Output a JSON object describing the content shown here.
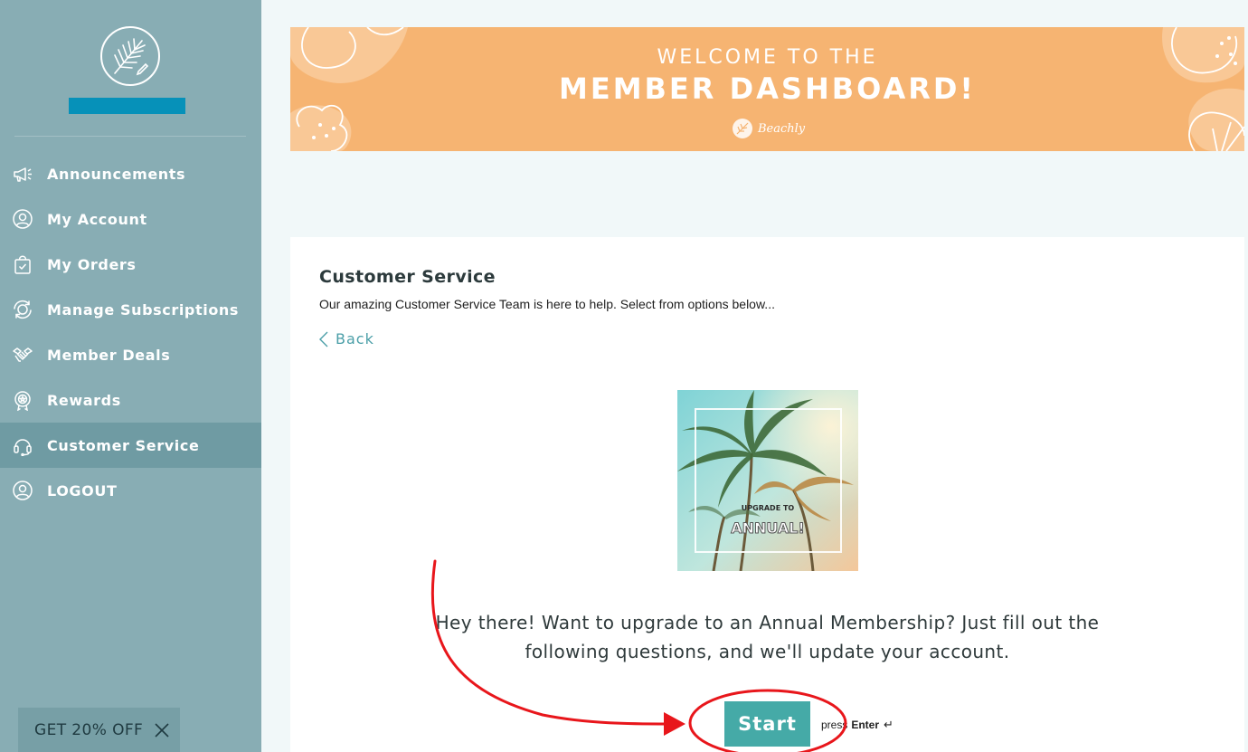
{
  "sidebar": {
    "items": [
      {
        "label": "Announcements",
        "icon": "megaphone-icon",
        "active": false
      },
      {
        "label": "My Account",
        "icon": "user-circle-icon",
        "active": false
      },
      {
        "label": "My Orders",
        "icon": "shopping-bag-icon",
        "active": false
      },
      {
        "label": "Manage Subscriptions",
        "icon": "refresh-circle-icon",
        "active": false
      },
      {
        "label": "Member Deals",
        "icon": "handshake-icon",
        "active": false
      },
      {
        "label": "Rewards",
        "icon": "award-icon",
        "active": false
      },
      {
        "label": "Customer Service",
        "icon": "headset-icon",
        "active": true
      },
      {
        "label": "LOGOUT",
        "icon": "user-circle-icon",
        "active": false
      }
    ],
    "promo": {
      "label": "GET 20% OFF"
    }
  },
  "banner": {
    "line1": "WELCOME TO THE",
    "line2": "MEMBER DASHBOARD!",
    "brand": "Beachly"
  },
  "main": {
    "title": "Customer Service",
    "subtitle": "Our amazing Customer Service Team is here to help. Select from options below...",
    "back_label": "Back",
    "image": {
      "line1": "UPGRADE TO",
      "line2": "ANNUAL!"
    },
    "message": "Hey there! Want to upgrade to an Annual Membership? Just fill out the following questions, and we'll update your account.",
    "start_label": "Start",
    "press_label": "press",
    "key_label": "Enter",
    "return_glyph": "↵"
  },
  "colors": {
    "sidebar_bg": "#88adb4",
    "sidebar_active": "#6f9ba3",
    "banner_bg": "#f6b472",
    "accent": "#45aaa7",
    "annotation": "#e8161b"
  }
}
